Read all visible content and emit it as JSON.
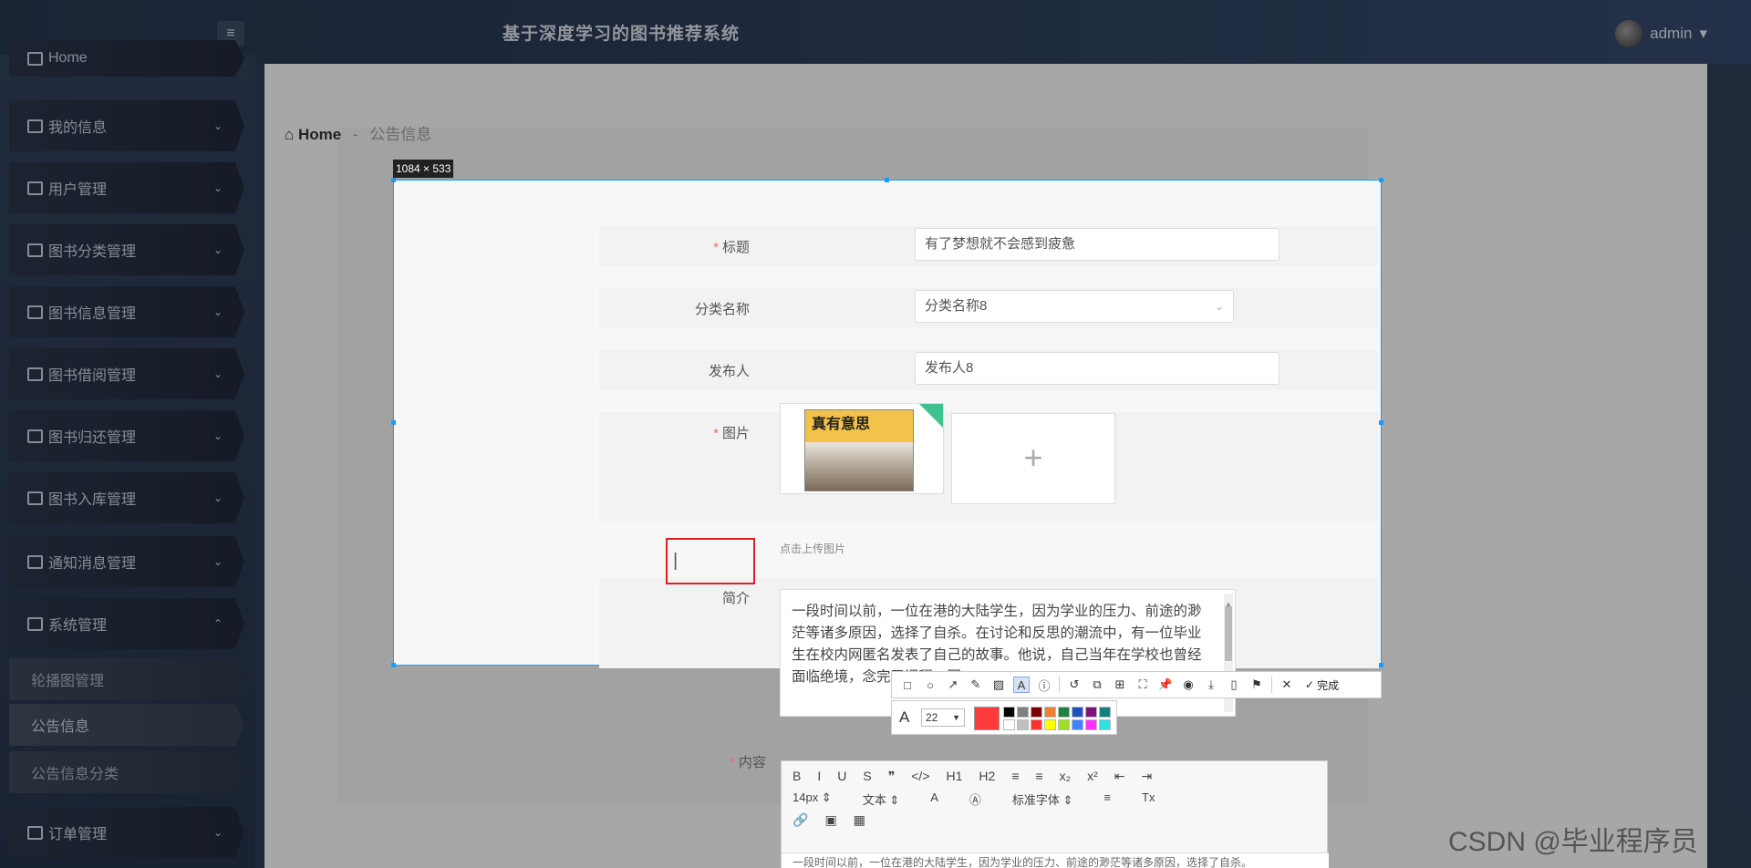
{
  "header": {
    "menu_icon": "hamburger-icon",
    "title": "基于深度学习的图书推荐系统",
    "user": "admin",
    "user_caret": "▾"
  },
  "sidebar": {
    "items": [
      {
        "label": "Home",
        "icon": "home-icon"
      },
      {
        "label": "我的信息",
        "icon": "card-icon"
      },
      {
        "label": "用户管理",
        "icon": "grid-icon"
      },
      {
        "label": "图书分类管理",
        "icon": "briefcase-icon"
      },
      {
        "label": "图书信息管理",
        "icon": "grid-icon"
      },
      {
        "label": "图书借阅管理",
        "icon": "user-icon"
      },
      {
        "label": "图书归还管理",
        "icon": "monitor-icon"
      },
      {
        "label": "图书入库管理",
        "icon": "chart-icon"
      },
      {
        "label": "通知消息管理",
        "icon": "clipboard-icon"
      },
      {
        "label": "系统管理",
        "icon": "grid-icon"
      },
      {
        "label": "订单管理",
        "icon": "grid-icon"
      }
    ],
    "sub_items": [
      "轮播图管理",
      "公告信息",
      "公告信息分类"
    ]
  },
  "breadcrumb": {
    "home": "Home",
    "sep": "-",
    "current": "公告信息"
  },
  "capture": {
    "size_label": "1084 × 533",
    "font_size": "22",
    "done_label": "完成"
  },
  "form": {
    "title_label": "标题",
    "title_value": "有了梦想就不会感到疲惫",
    "category_label": "分类名称",
    "category_value": "分类名称8",
    "publisher_label": "发布人",
    "publisher_value": "发布人8",
    "image_label": "图片",
    "cover_text": "真有意思",
    "upload_hint": "点击上传图片",
    "upload_plus": "+",
    "intro_label": "简介",
    "intro_value": "一段时间以前，一位在港的大陆学生，因为学业的压力、前途的渺茫等诸多原因，选择了自杀。在讨论和反思的潮流中，有一位毕业生在校内网匿名发表了自己的故事。他说，自己当年在学校也曾经面临绝境，念完了课程。回",
    "content_label": "内容",
    "editor_body": "一段时间以前，一位在港的大陆学生，因为学业的压力、前途的渺茫等诸多原因，选择了自杀。"
  },
  "editor_toolbar": {
    "row1": [
      "B",
      "I",
      "U",
      "S",
      "❞",
      "</>",
      "H1",
      "H2",
      "≡",
      "≡",
      "x₂",
      "x²",
      "⇤",
      "⇥"
    ],
    "row2": [
      "14px ⇕",
      "文本 ⇕",
      "A",
      "Ⓐ",
      "标准字体 ⇕",
      "≡",
      "Tx"
    ],
    "row3": [
      "🔗",
      "▣",
      "▦"
    ]
  },
  "palette": [
    "#000000",
    "#808080",
    "#800000",
    "#f08030",
    "#208040",
    "#2050c0",
    "#801080",
    "#108080",
    "#ffffff",
    "#c0c0c0",
    "#ff3030",
    "#ffff00",
    "#a0e020",
    "#4080ff",
    "#ff30ff",
    "#30e0e0"
  ],
  "watermark": "CSDN @毕业程序员"
}
